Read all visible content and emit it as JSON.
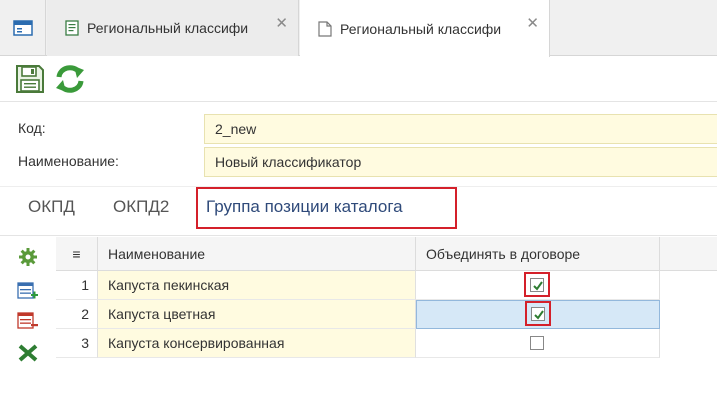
{
  "tabs": [
    {
      "label": "Региональный классифи",
      "close": "✕",
      "icon": "document-icon"
    },
    {
      "label": "Региональный классифи",
      "close": "✕",
      "icon": "document-icon"
    }
  ],
  "toolbar": {
    "save_icon": "save-icon",
    "refresh_icon": "refresh-icon"
  },
  "form": {
    "code_label": "Код:",
    "code_value": "2_new",
    "name_label": "Наименование:",
    "name_value": "Новый классификатор"
  },
  "subtabs": [
    "ОКПД",
    "ОКПД2",
    "Группа позиции каталога"
  ],
  "side_tools": [
    "settings-gear-icon",
    "add-row-icon",
    "delete-row-icon",
    "excel-export-icon"
  ],
  "grid": {
    "columns": {
      "menu_icon": "≡",
      "name": "Наименование",
      "merge": "Объединять в договоре"
    },
    "rows": [
      {
        "num": "1",
        "name": "Капуста пекинская",
        "merge_checked": true
      },
      {
        "num": "2",
        "name": "Капуста цветная",
        "merge_checked": true
      },
      {
        "num": "3",
        "name": "Капуста консервированная",
        "merge_checked": false
      }
    ]
  },
  "colors": {
    "highlight": "#d4202a",
    "field_bg": "#fffbe0",
    "selected_cell": "#d6e8f7",
    "active_tab_text": "#2f4a7a"
  }
}
